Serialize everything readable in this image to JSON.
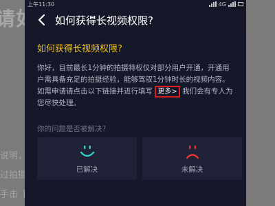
{
  "background": {
    "heading": "请如",
    "lines": [
      "说明，",
      "过拍摄",
      "手击【"
    ]
  },
  "statusbar": {
    "time": "上午11:30",
    "network": "4G"
  },
  "header": {
    "title": "如何获得长视频权限?"
  },
  "article": {
    "question": "如何获得长视频权限?",
    "answer_part1": "你好，目前最长1分钟的拍摄特权仅对部分用户开通，开通用户需具备充足的拍摄经验，能够驾驭1分钟时长的视频内容。如需申请请点击以下链接并进行填写",
    "more_link": "更多>",
    "answer_part2": "我们会有专人为您尽快处理。"
  },
  "feedback": {
    "label": "你的问题是否被解决?",
    "resolved_label": "已解决",
    "unresolved_label": "未解决"
  },
  "colors": {
    "accent": "#f1c21b",
    "positive": "#35d0c8",
    "negative": "#e8332f",
    "highlight_box": "#e21b1b"
  }
}
